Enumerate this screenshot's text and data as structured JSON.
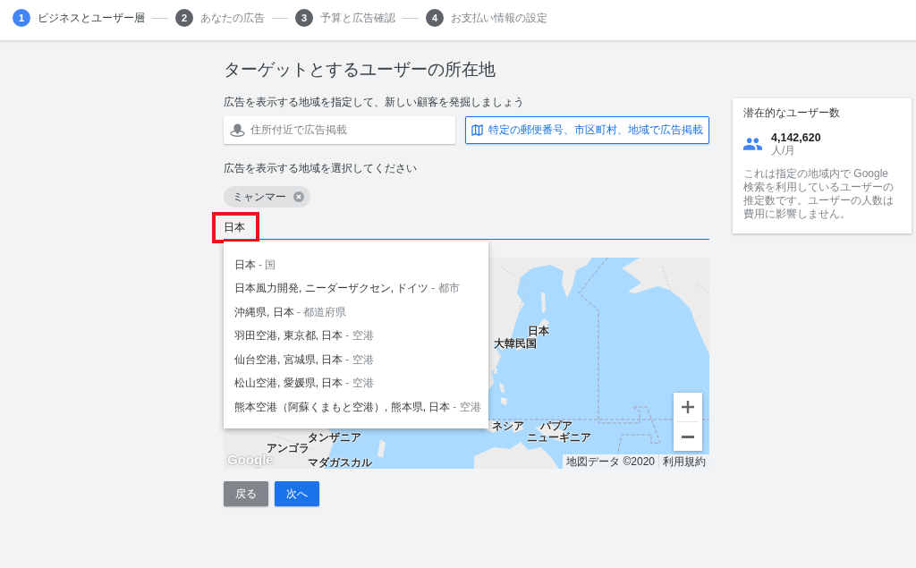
{
  "stepper": {
    "steps": [
      {
        "number": "1",
        "label": "ビジネスとユーザー層",
        "selected": true
      },
      {
        "number": "2",
        "label": "あなたの広告",
        "selected": false
      },
      {
        "number": "3",
        "label": "予算と広告確認",
        "selected": false
      },
      {
        "number": "4",
        "label": "お支払い情報の設定",
        "selected": false
      }
    ]
  },
  "location": {
    "title": "ターゲットとするユーザーの所在地",
    "intro": "広告を表示する地域を指定して、新しい顧客を発掘しましょう",
    "options": [
      {
        "kind": "radius",
        "label": "住所付近で広告掲載",
        "selected": false
      },
      {
        "kind": "regions",
        "label": "特定の郵便番号、市区町村、地域で広告掲載",
        "selected": true
      }
    ],
    "select_label": "広告を表示する地域を選択してください",
    "chips": [
      {
        "label": "ミャンマー"
      }
    ],
    "search": {
      "value": "日本",
      "highlighted": true
    },
    "suggestions": [
      {
        "name": "日本",
        "type": "- 国"
      },
      {
        "name": "日本風力開発, ニーダーザクセン, ドイツ",
        "type": "- 都市"
      },
      {
        "name": "沖縄県, 日本",
        "type": "- 都道府県"
      },
      {
        "name": "羽田空港, 東京都, 日本",
        "type": "- 空港"
      },
      {
        "name": "仙台空港, 宮城県, 日本",
        "type": "- 空港"
      },
      {
        "name": "松山空港, 愛媛県, 日本",
        "type": "- 空港"
      },
      {
        "name": "熊本空港（阿蘇くまもと空港）, 熊本県, 日本",
        "type": "- 空港"
      }
    ]
  },
  "map": {
    "labels": [
      "日本",
      "大韓民国",
      "ネシア",
      "パプア",
      "タンザニア",
      "ニューギニア",
      "アンゴラ",
      "マダガスカル"
    ],
    "logo": "Google",
    "attribution": "地図データ ©2020",
    "terms": "利用規約"
  },
  "audience": {
    "title": "潜在的なユーザー数",
    "count": "4,142,620",
    "unit": "人/月",
    "note": "これは指定の地域内で Google 検索を利用しているユーザーの推定数です。ユーザーの人数は費用に影響しません。"
  },
  "buttons": [
    {
      "kind": "back",
      "label": "戻る"
    },
    {
      "kind": "next",
      "label": "次へ"
    }
  ]
}
